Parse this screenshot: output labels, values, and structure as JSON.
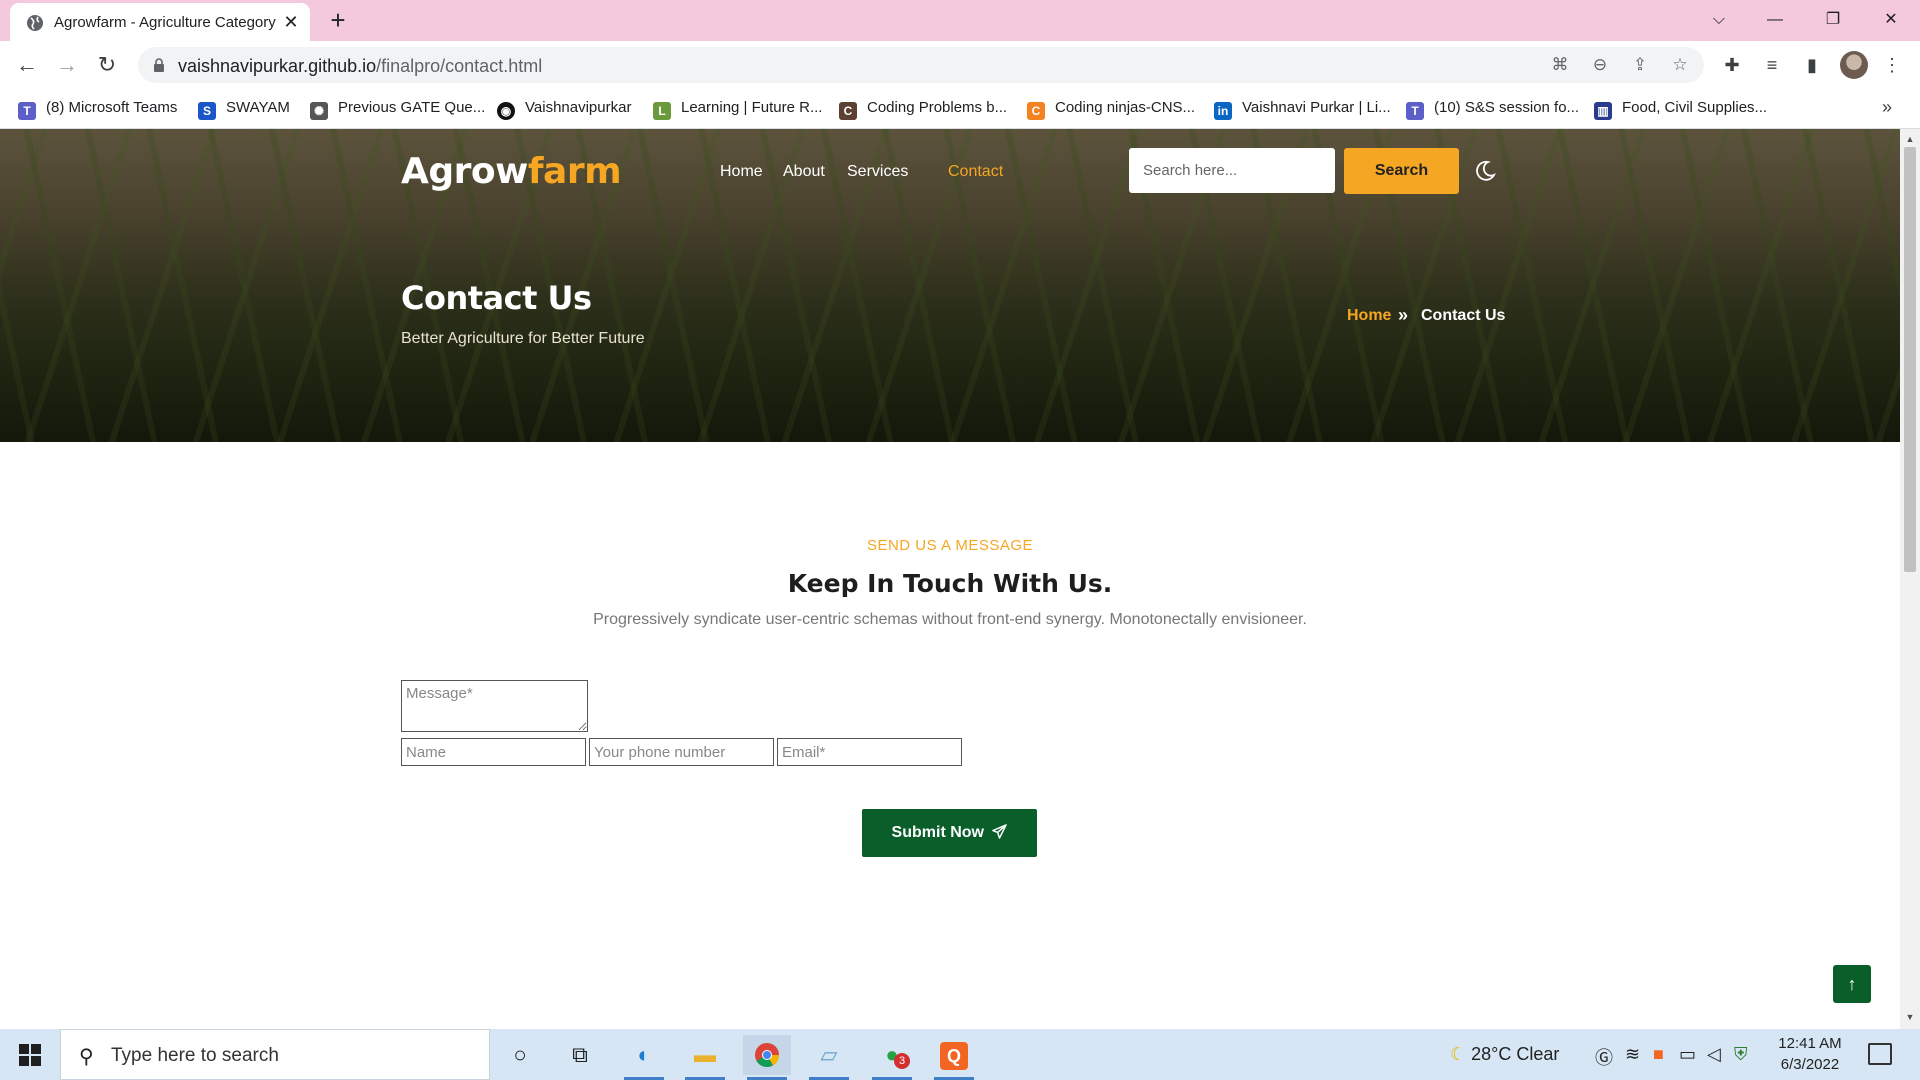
{
  "browser": {
    "tab_title": "Agrowfarm - Agriculture Category",
    "url_host": "vaishnavipurkar.github.io",
    "url_path": "/finalpro/contact.html",
    "bookmarks": [
      {
        "label": "(8) Microsoft Teams",
        "icon": "teams-icon",
        "color": "#5b5fc7"
      },
      {
        "label": "SWAYAM",
        "icon": "swayam-icon",
        "color": "#1a56c8"
      },
      {
        "label": "Previous GATE Que...",
        "icon": "gate-icon",
        "color": "#555555"
      },
      {
        "label": "Vaishnavipurkar",
        "icon": "github-icon",
        "color": "#111111"
      },
      {
        "label": "Learning | Future R...",
        "icon": "learning-icon",
        "color": "#6a9a3c"
      },
      {
        "label": "Coding Problems b...",
        "icon": "codechef-icon",
        "color": "#5c4033"
      },
      {
        "label": "Coding ninjas-CNS...",
        "icon": "codingninjas-icon",
        "color": "#f58220"
      },
      {
        "label": "Vaishnavi Purkar | Li...",
        "icon": "linkedin-icon",
        "color": "#0a66c2"
      },
      {
        "label": "(10) S&S session fo...",
        "icon": "teams-icon",
        "color": "#5b5fc7"
      },
      {
        "label": "Food, Civil Supplies...",
        "icon": "gov-icon",
        "color": "#2a3a8c"
      }
    ]
  },
  "site": {
    "logo_main": "Agrow",
    "logo_accent": "farm",
    "nav": [
      "Home",
      "About",
      "Services",
      "Contact"
    ],
    "search_placeholder": "Search here...",
    "search_button": "Search",
    "hero_title": "Contact Us",
    "hero_subtitle": "Better Agriculture for Better Future",
    "breadcrumb_home": "Home",
    "breadcrumb_sep": "»",
    "breadcrumb_current": "Contact Us",
    "eyebrow": "SEND US A MESSAGE",
    "section_title": "Keep In Touch With Us.",
    "section_desc": "Progressively syndicate user-centric schemas without front-end synergy. Monotonectally envisioneer.",
    "form": {
      "message_placeholder": "Message*",
      "name_placeholder": "Name",
      "phone_placeholder": "Your phone number",
      "email_placeholder": "Email*",
      "submit_label": "Submit Now"
    },
    "back_to_top": "↑",
    "colors": {
      "accent": "#f5a623",
      "primary_green": "#0a5e2a"
    }
  },
  "taskbar": {
    "search_placeholder": "Type here to search",
    "weather": "28°C  Clear",
    "time": "12:41 AM",
    "date": "6/3/2022",
    "whatsapp_badge": "3"
  }
}
